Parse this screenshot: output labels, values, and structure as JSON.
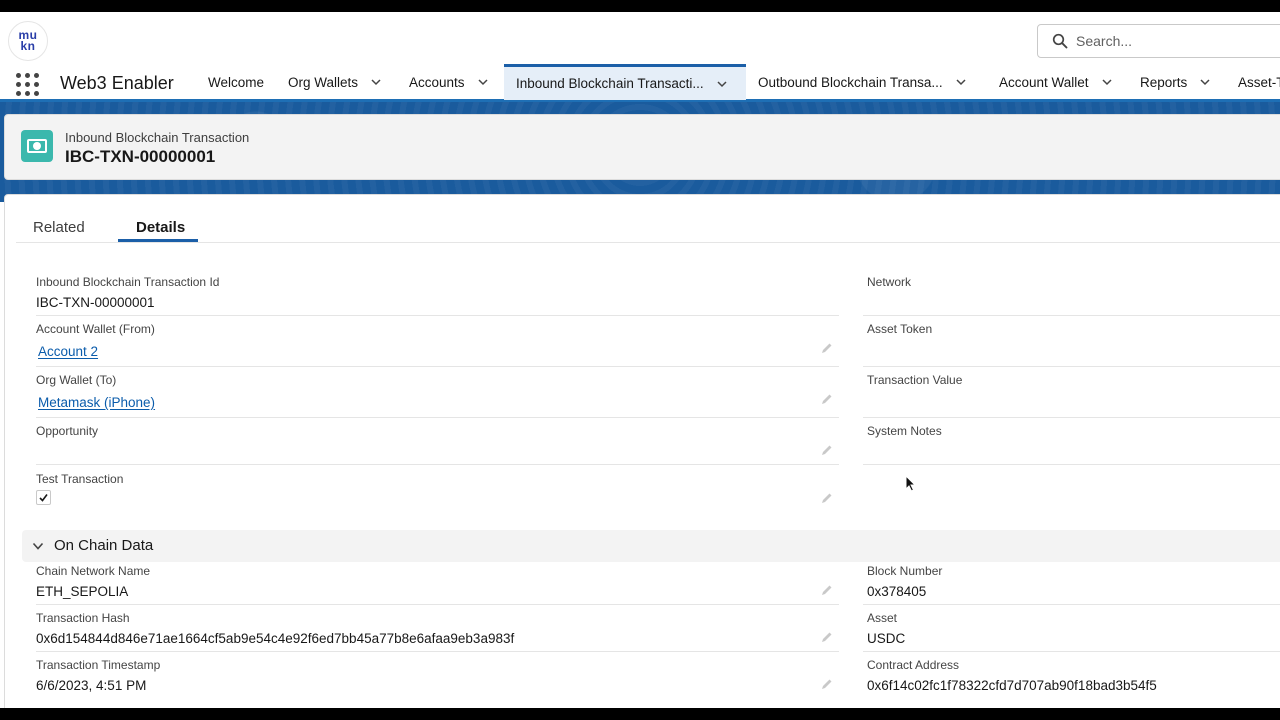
{
  "header": {
    "logo_lines": [
      "mu",
      "kn"
    ],
    "search_placeholder": "Search...",
    "app_name": "Web3 Enabler"
  },
  "nav": {
    "tabs": [
      {
        "label": "Welcome",
        "has_menu": false
      },
      {
        "label": "Org Wallets",
        "has_menu": true
      },
      {
        "label": "Accounts",
        "has_menu": true
      },
      {
        "label": "Inbound Blockchain Transacti...",
        "has_menu": true,
        "active": true
      },
      {
        "label": "Outbound Blockchain Transa...",
        "has_menu": true
      },
      {
        "label": "Account Wallet",
        "has_menu": true
      },
      {
        "label": "Reports",
        "has_menu": true
      },
      {
        "label": "Asset-T",
        "has_menu": false
      }
    ]
  },
  "record": {
    "object_type": "Inbound Blockchain Transaction",
    "name": "IBC-TXN-00000001"
  },
  "record_tabs": {
    "related": "Related",
    "details": "Details",
    "active": "details"
  },
  "details": {
    "left": [
      {
        "label": "Inbound Blockchain Transaction Id",
        "value": "IBC-TXN-00000001"
      },
      {
        "label": "Account Wallet (From)",
        "value": "Account 2"
      },
      {
        "label": "Org Wallet (To)",
        "value": "Metamask (iPhone)"
      },
      {
        "label": "Opportunity",
        "value": ""
      },
      {
        "label": "Test Transaction",
        "checked": true
      }
    ],
    "right": [
      {
        "label": "Network",
        "value": ""
      },
      {
        "label": "Asset Token",
        "value": ""
      },
      {
        "label": "Transaction Value",
        "value": ""
      },
      {
        "label": "System Notes",
        "value": ""
      }
    ]
  },
  "on_chain": {
    "title": "On Chain Data",
    "left": [
      {
        "label": "Chain Network Name",
        "value": "ETH_SEPOLIA"
      },
      {
        "label": "Transaction Hash",
        "value": "0x6d154844d846e71ae1664cf5ab9e54c4e92f6ed7bb45a77b8e6afaa9eb3a983f"
      },
      {
        "label": "Transaction Timestamp",
        "value": "6/6/2023, 4:51 PM"
      }
    ],
    "right": [
      {
        "label": "Block Number",
        "value": "0x378405"
      },
      {
        "label": "Asset",
        "value": "USDC"
      },
      {
        "label": "Contract Address",
        "value": "0x6f14c02fc1f78322cfd7d707ab90f18bad3b54f5"
      }
    ]
  },
  "colors": {
    "brand_blue": "#1b5fa8",
    "link": "#0b5cab",
    "record_icon": "#3bb8ad",
    "banner": "#1a5b9d"
  }
}
